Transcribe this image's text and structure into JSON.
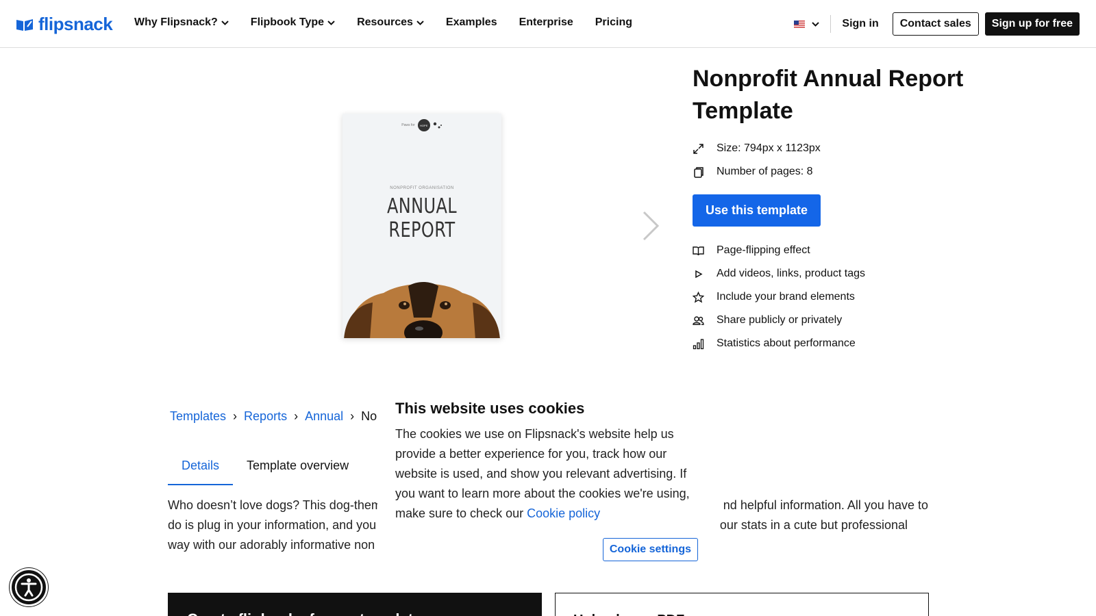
{
  "header": {
    "logo_text": "flipsnack",
    "nav": [
      {
        "label": "Why Flipsnack?",
        "has_dropdown": true
      },
      {
        "label": "Flipbook Type",
        "has_dropdown": true
      },
      {
        "label": "Resources",
        "has_dropdown": true
      },
      {
        "label": "Examples",
        "has_dropdown": false
      },
      {
        "label": "Enterprise",
        "has_dropdown": false
      },
      {
        "label": "Pricing",
        "has_dropdown": false
      }
    ],
    "language_icon": "us-flag-icon",
    "sign_in": "Sign in",
    "contact_sales": "Contact sales",
    "sign_up": "Sign up for free"
  },
  "preview": {
    "brand_small": "Paws for",
    "brand_logo": "HOPE",
    "subtitle": "NONPROFIT ORGANISATION",
    "title": "ANNUAL REPORT"
  },
  "info": {
    "title": "Nonprofit Annual Report Template",
    "size": "Size: 794px x 1123px",
    "pages": "Number of pages: 8",
    "cta": "Use this template",
    "features": [
      {
        "icon": "book-icon",
        "label": "Page-flipping effect"
      },
      {
        "icon": "play-icon",
        "label": "Add videos, links, product tags"
      },
      {
        "icon": "star-icon",
        "label": "Include your brand elements"
      },
      {
        "icon": "people-icon",
        "label": "Share publicly or privately"
      },
      {
        "icon": "bar-chart-icon",
        "label": "Statistics about performance"
      }
    ]
  },
  "breadcrumbs": {
    "items": [
      "Templates",
      "Reports",
      "Annual"
    ],
    "current": "Nor",
    "separator": "›"
  },
  "tabs": [
    "Details",
    "Template overview"
  ],
  "description": {
    "line1_left": "Who doesn’t love dogs? This dog-them",
    "line1_right": "nd helpful information. All you have to",
    "line2_left": "do is plug in your information, and you",
    "line2_right": "your stats in a cute but professional",
    "line3_left": "way with our adorably informative non"
  },
  "bottom": {
    "dark_box": "Create flipbooks from a template",
    "light_box": "Upload your PDF"
  },
  "cookie": {
    "title": "This website uses cookies",
    "text": "The cookies we use on Flipsnack's website help us provide a better experience for you, track how our website is used, and show you relevant advertising. If you want to learn more about the cookies we're using, make sure to check our",
    "link": "Cookie policy",
    "button": "Cookie settings"
  },
  "colors": {
    "accent": "#1466e8",
    "link": "#1565d8",
    "dark": "#111111"
  }
}
